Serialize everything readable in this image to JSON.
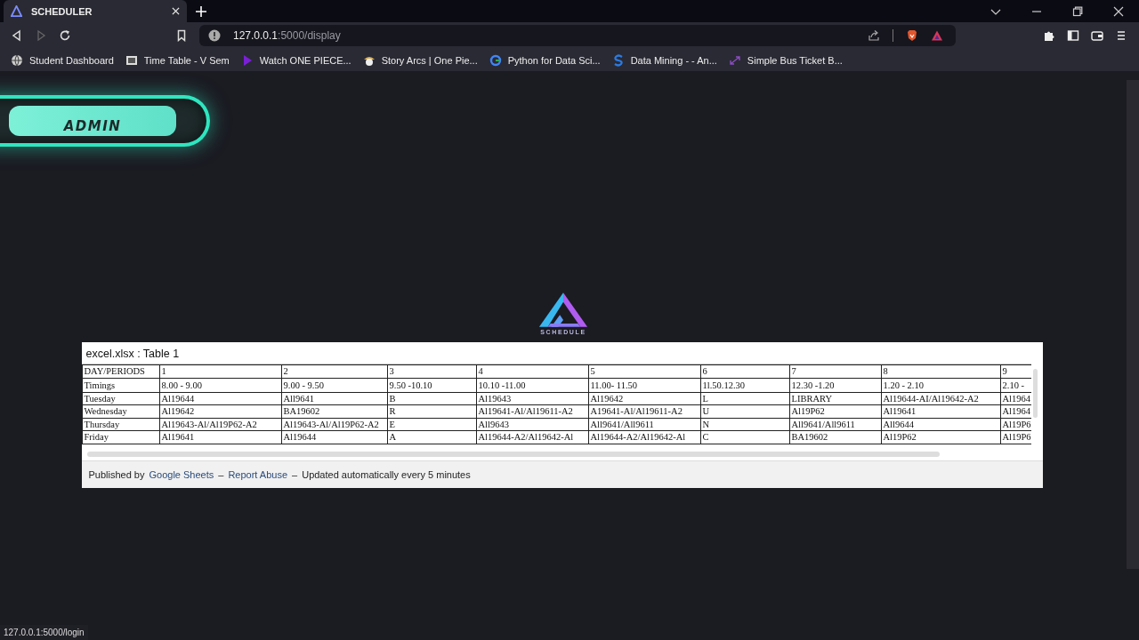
{
  "browser": {
    "tabs": [
      {
        "title": "SCHEDULER",
        "selected": true
      }
    ],
    "address": {
      "host": "127.0.0.1",
      "path": ":5000/display"
    },
    "bookmarks": [
      "Student Dashboard",
      "Time Table - V Sem",
      "Watch ONE PIECE...",
      "Story Arcs | One Pie...",
      "Python for Data Sci...",
      "Data Mining - - An...",
      "Simple Bus Ticket B..."
    ]
  },
  "page": {
    "admin_button": "ADMIN",
    "logo": {
      "wordmark": "SCHEDULE"
    },
    "sheet": {
      "title": "excel.xlsx : Table 1",
      "rows": [
        [
          "DAY/PERIODS",
          "1",
          "2",
          "3",
          "4",
          "5",
          "6",
          "7",
          "8",
          "9"
        ],
        [
          "Timings",
          "8.00 - 9.00",
          "9.00 - 9.50",
          "9.50 -10.10",
          "10.10 -11.00",
          "11.00- 11.50",
          "1l.50.12.30",
          "12.30 -1.20",
          "1.20 - 2.10",
          "2.10 -"
        ],
        [
          "Tuesday",
          "Al19644",
          "All9641",
          "B",
          "Al19643",
          "Al19642",
          "L",
          "LIBRARY",
          "Al19644-AI/Al19642-A2",
          "Al1964"
        ],
        [
          "Wednesday",
          "Al19642",
          "BA19602",
          "R",
          "Al19641-Al/Al19611-A2",
          "A19641-Al/Al19611-A2",
          "U",
          "Al19P62",
          "Al19641",
          "Al1964"
        ],
        [
          "Thursday",
          "Al19643-Al/Al19P62-A2",
          "Al19643-Al/Al19P62-A2",
          "E",
          "All9643",
          "All9641/All9611",
          "N",
          "All9641/All9611",
          "All9644",
          "Al19P6"
        ],
        [
          "Friday",
          "Al19641",
          "Al19644",
          "A",
          "Al19644-A2/Al19642-Al",
          "Al19644-A2/Al19642-Al",
          "C",
          "BA19602",
          "Al19P62",
          "Al19P6"
        ]
      ],
      "footer": {
        "prefix": "Published by",
        "link1": "Google Sheets",
        "sep1": "–",
        "link2": "Report Abuse",
        "sep2": "–",
        "note": "Updated automatically every 5 minutes"
      }
    }
  },
  "status_bar": {
    "url": "127.0.0.1:5000/login"
  }
}
